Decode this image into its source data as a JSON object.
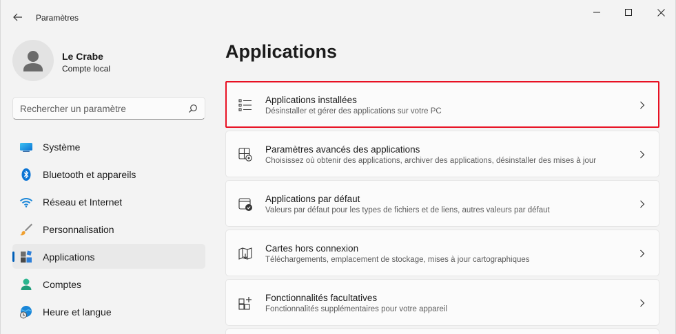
{
  "window": {
    "title": "Paramètres"
  },
  "profile": {
    "name": "Le Crabe",
    "account_type": "Compte local"
  },
  "search": {
    "placeholder": "Rechercher un paramètre"
  },
  "sidebar": {
    "items": [
      {
        "label": "Système",
        "icon": "system-icon"
      },
      {
        "label": "Bluetooth et appareils",
        "icon": "bluetooth-icon"
      },
      {
        "label": "Réseau et Internet",
        "icon": "wifi-icon"
      },
      {
        "label": "Personnalisation",
        "icon": "brush-icon"
      },
      {
        "label": "Applications",
        "icon": "apps-icon",
        "selected": true
      },
      {
        "label": "Comptes",
        "icon": "account-icon"
      },
      {
        "label": "Heure et langue",
        "icon": "time-language-icon"
      }
    ]
  },
  "main": {
    "title": "Applications",
    "cards": [
      {
        "title": "Applications installées",
        "subtitle": "Désinstaller et gérer des applications sur votre PC",
        "icon": "installed-apps-icon",
        "highlighted": true
      },
      {
        "title": "Paramètres avancés des applications",
        "subtitle": "Choisissez où obtenir des applications, archiver des applications, désinstaller des mises à jour",
        "icon": "advanced-apps-icon"
      },
      {
        "title": "Applications par défaut",
        "subtitle": "Valeurs par défaut pour les types de fichiers et de liens, autres valeurs par défaut",
        "icon": "default-apps-icon"
      },
      {
        "title": "Cartes hors connexion",
        "subtitle": "Téléchargements, emplacement de stockage, mises à jour cartographiques",
        "icon": "offline-maps-icon"
      },
      {
        "title": "Fonctionnalités facultatives",
        "subtitle": "Fonctionnalités supplémentaires pour votre appareil",
        "icon": "optional-features-icon"
      }
    ]
  },
  "colors": {
    "accent": "#005fb8",
    "highlight_border": "#e81123",
    "background": "#f3f3f3"
  }
}
